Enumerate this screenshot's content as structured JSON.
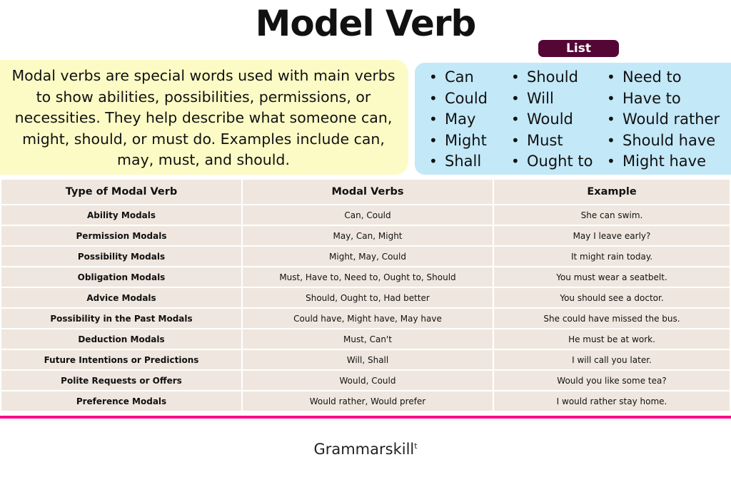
{
  "title": "Model Verb",
  "list_label": "List",
  "description": "Modal verbs are special words used with main verbs to show abilities, possibilities, permissions, or necessities. They help describe what someone can, might, should, or must do. Examples include can, may, must, and should.",
  "list_columns": [
    [
      "Can",
      "Could",
      "May",
      "Might",
      "Shall"
    ],
    [
      "Should",
      "Will",
      "Would",
      "Must",
      "Ought to"
    ],
    [
      "Need to",
      "Have to",
      "Would rather",
      "Should have",
      "Might have"
    ]
  ],
  "table": {
    "headers": [
      "Type of Modal Verb",
      "Modal Verbs",
      "Example"
    ],
    "rows": [
      [
        "Ability Modals",
        "Can, Could",
        "She can swim."
      ],
      [
        "Permission Modals",
        "May, Can, Might",
        "May I leave early?"
      ],
      [
        "Possibility Modals",
        "Might, May, Could",
        "It might rain today."
      ],
      [
        "Obligation Modals",
        "Must, Have to, Need to, Ought to, Should",
        "You must wear a seatbelt."
      ],
      [
        "Advice Modals",
        "Should, Ought to, Had better",
        "You should see a doctor."
      ],
      [
        "Possibility in the Past Modals",
        "Could have, Might have, May have",
        "She could have missed the bus."
      ],
      [
        "Deduction Modals",
        "Must, Can't",
        "He must be at work."
      ],
      [
        "Future Intentions or Predictions",
        "Will, Shall",
        "I will call you later."
      ],
      [
        "Polite Requests or Offers",
        "Would, Could",
        "Would you like some tea?"
      ],
      [
        "Preference Modals",
        "Would rather, Would prefer",
        "I would rather stay home."
      ]
    ]
  },
  "footer": {
    "brand": "Grammarskill",
    "superscript": "t"
  },
  "colors": {
    "badge": "#540735",
    "description_bg": "#fcfbc6",
    "list_bg": "#c3e8f8",
    "table_bg": "#efe7df",
    "divider": "#ff0a8a"
  }
}
